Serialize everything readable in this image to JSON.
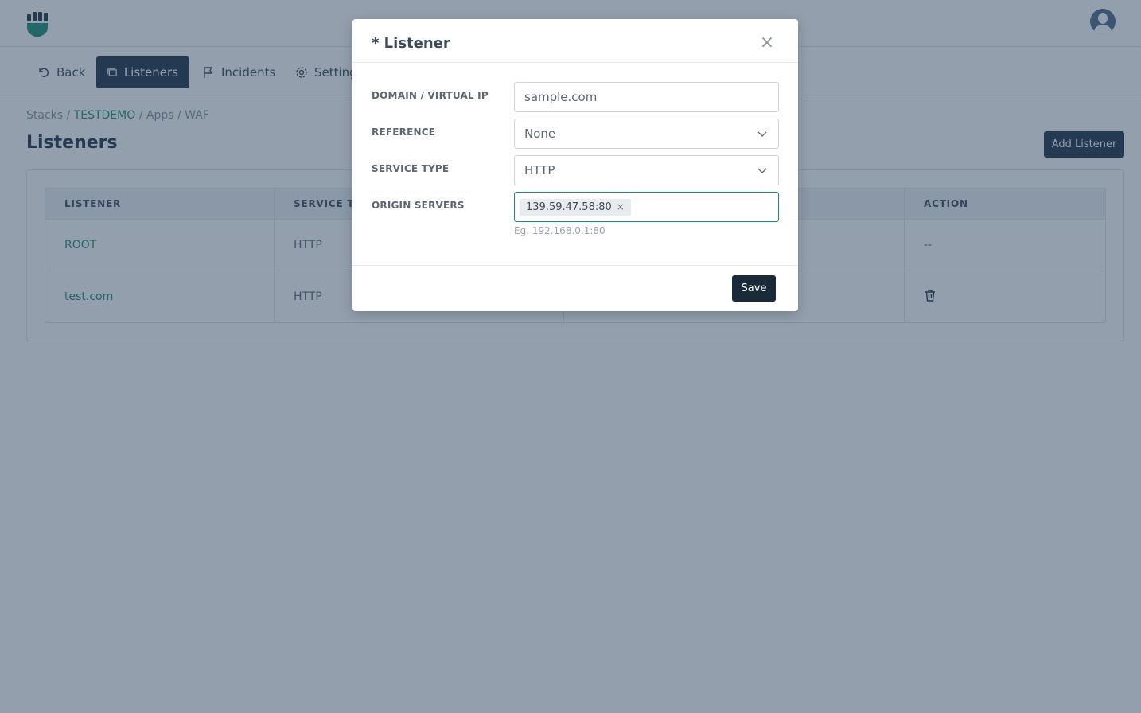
{
  "nav": {
    "items": [
      {
        "label": "Back",
        "icon": "undo-icon"
      },
      {
        "label": "Listeners",
        "icon": "listeners-icon",
        "active": true
      },
      {
        "label": "Incidents",
        "icon": "flag-icon"
      },
      {
        "label": "Settings",
        "icon": "gear-icon"
      }
    ]
  },
  "breadcrumb": {
    "stacks": "Stacks",
    "sep": "/",
    "stack": "TESTDEMO",
    "apps": "Apps",
    "app": "WAF"
  },
  "page": {
    "title": "Listeners",
    "add_label": "Add Listener"
  },
  "table": {
    "headers": [
      "LISTENER",
      "SERVICE TYPE",
      "",
      "ACTION"
    ],
    "rows": [
      {
        "listener": "ROOT",
        "service_type": "HTTP",
        "origin": "",
        "action": "--"
      },
      {
        "listener": "test.com",
        "service_type": "HTTP",
        "origin": "",
        "action": "trash-icon"
      }
    ]
  },
  "modal": {
    "title": "* Listener",
    "fields": {
      "domain_label": "DOMAIN / VIRTUAL IP",
      "domain_value": "sample.com",
      "reference_label": "REFERENCE",
      "reference_value": "None",
      "service_type_label": "SERVICE TYPE",
      "service_type_value": "HTTP",
      "origin_label": "ORIGIN SERVERS",
      "origin_tag": "139.59.47.58:80",
      "origin_hint": "Eg. 192.168.0.1:80"
    },
    "save_label": "Save"
  },
  "colors": {
    "accent": "#1c8f78",
    "primary": "#1f3448",
    "overlay": "rgba(40,64,92,0.5)"
  }
}
